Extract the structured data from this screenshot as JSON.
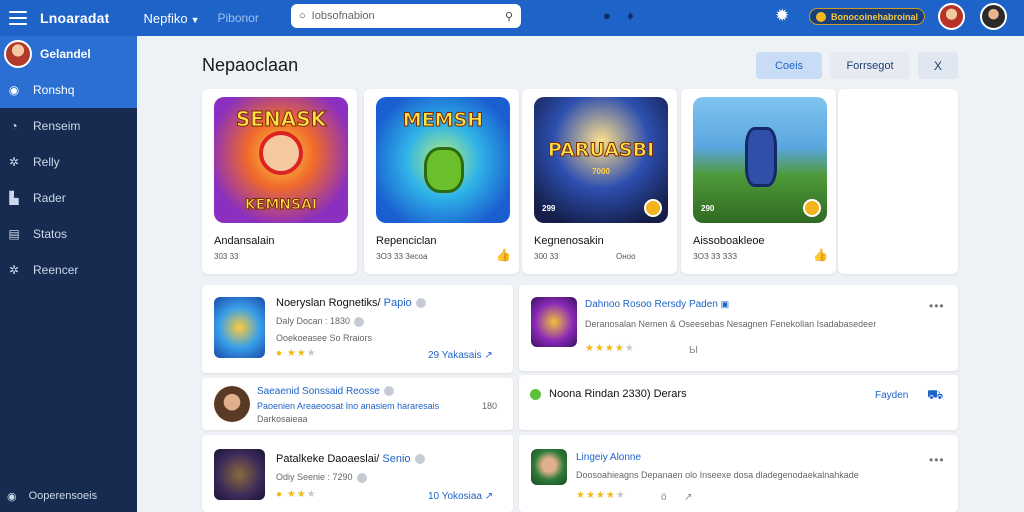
{
  "topbar": {
    "brand": "Lnoaradat",
    "nav_dropdown": "Nepfiko",
    "nav_link": "Pibonor",
    "search_placeholder": "Iobsofnabion",
    "coins_label": "Bonocoinehabroinal"
  },
  "sidebar": {
    "user_name": "Gelandel",
    "items": [
      {
        "label": "Ronshq",
        "icon": "gamepad-icon",
        "glyph": "◉"
      },
      {
        "label": "Renseim",
        "icon": "clock-icon",
        "glyph": "◔"
      },
      {
        "label": "Relly",
        "icon": "gear-icon",
        "glyph": "✲"
      },
      {
        "label": "Rader",
        "icon": "bag-icon",
        "glyph": "▙"
      },
      {
        "label": "Statos",
        "icon": "calendar-icon",
        "glyph": "▤"
      },
      {
        "label": "Reencer",
        "icon": "settings-icon",
        "glyph": "✲"
      }
    ],
    "bottom_label": "Ooperensoeis"
  },
  "main": {
    "title": "Nepaoclaan",
    "buttons": {
      "primary": "Coeis",
      "secondary": "Forrsegot",
      "close": "X"
    },
    "games": [
      {
        "title": "Andansalain",
        "meta": "303 33",
        "price": "",
        "logo": "SENASK",
        "subtitle": "KEMNSAI"
      },
      {
        "title": "Repenciclan",
        "meta": "ЗОЗ 33 Зесоа",
        "price": "",
        "logo": "MEMSH",
        "subtitle": ""
      },
      {
        "title": "Kegnenosakin",
        "meta": "300 33",
        "price": "Оноо",
        "logo": "PARUASBI",
        "subtitle": "7000",
        "badge": "299"
      },
      {
        "title": "Aissoboakleoe",
        "meta": "ЗОЗ 3З ЗЗЗ",
        "price": "",
        "logo": "",
        "subtitle": "",
        "badge": "290"
      }
    ],
    "feed": [
      {
        "title": "Noeryslan Rognetiks/",
        "tag": "Papio",
        "sub": "Daly Docan : 1830",
        "sub2": "Ooekoeasee So Rraiors",
        "count": "29 Yakasais"
      },
      {
        "title": "Dahnoo Rosoo Rersdy Paden",
        "desc": "Deranosalan Nemen & Oseesebas Nesagnen Fenekollan Isadabasedeer",
        "count": "Ы"
      },
      {
        "title": "Saeaenid Sonssaid Reosse",
        "sub": "Paoenien Areaeoosat Ino anasiem hararesais",
        "sub2": "Darkosaieaa",
        "count": "180"
      },
      {
        "title": "Noona Rindan  2330) Derars",
        "link": "Fayden"
      },
      {
        "title": "Patalkeke Daoaeslai/",
        "tag": "Senio",
        "sub": "Odiy Seenie : 7290",
        "count": "10 Yokosiaa"
      },
      {
        "title": "Lingeiy Alonne",
        "desc": "Doosoahieagns Depanaen olo Inseexe dosa dladegenodaekalnahkade",
        "count": "ӧ"
      }
    ]
  },
  "colors": {
    "accent": "#1e63c7",
    "sidebar": "#172b50",
    "star": "#f2b91b"
  }
}
